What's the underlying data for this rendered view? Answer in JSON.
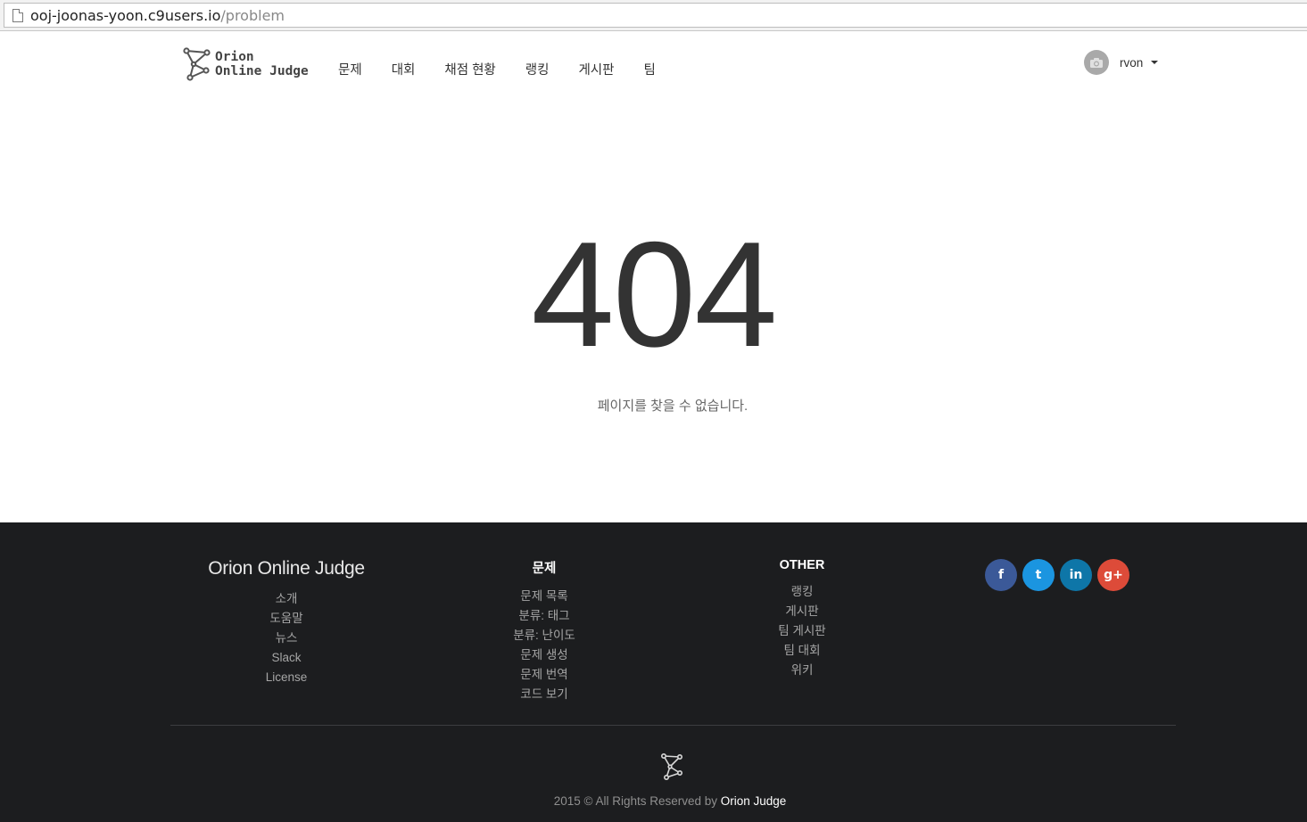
{
  "browser": {
    "url_host": "ooj-joonas-yoon.c9users.io",
    "url_path": "/problem"
  },
  "header": {
    "logo_line1": "Orion",
    "logo_line2": "Online Judge",
    "nav": [
      "문제",
      "대회",
      "채점 현황",
      "랭킹",
      "게시판",
      "팀"
    ],
    "username": "rvon"
  },
  "main": {
    "code": "404",
    "message": "페이지를 찾을 수 없습니다."
  },
  "footer": {
    "brand": "Orion Online Judge",
    "brand_links": [
      "소개",
      "도움말",
      "뉴스",
      "Slack",
      "License"
    ],
    "problem_head": "문제",
    "problem_links": [
      "문제 목록",
      "분류: 태그",
      "분류: 난이도",
      "문제 생성",
      "문제 번역",
      "코드 보기"
    ],
    "other_head": "OTHER",
    "other_links": [
      "랭킹",
      "게시판",
      "팀 게시판",
      "팀 대회",
      "위키"
    ],
    "social": [
      {
        "icon": "facebook-icon",
        "glyph": "f",
        "color": "#3b5998"
      },
      {
        "icon": "twitter-icon",
        "glyph": "t",
        "color": "#1b95e0"
      },
      {
        "icon": "linkedin-icon",
        "glyph": "in",
        "color": "#0e76a8"
      },
      {
        "icon": "google-plus-icon",
        "glyph": "g+",
        "color": "#dd4b39"
      }
    ],
    "copyright_prefix": "2015 © All Rights Reserved by ",
    "copyright_brand": "Orion Judge"
  }
}
